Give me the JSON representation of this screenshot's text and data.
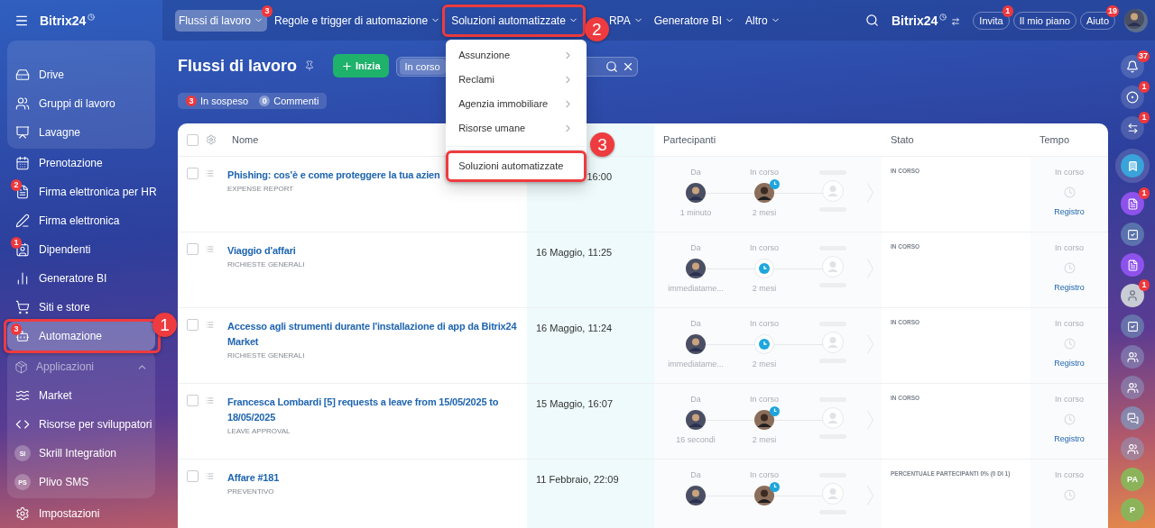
{
  "sidebar": {
    "logo": "Bitrix24",
    "pinned": [
      {
        "label": "Drive",
        "selected": false
      },
      {
        "label": "Gruppi di lavoro",
        "selected": false
      },
      {
        "label": "Lavagne",
        "selected": false
      }
    ],
    "items": [
      {
        "label": "Prenotazione",
        "selected": false
      },
      {
        "label": "Firma elettronica per HR",
        "selected": false,
        "badge": "2"
      },
      {
        "label": "Firma elettronica",
        "selected": false
      },
      {
        "label": "Dipendenti",
        "selected": false,
        "badge": "1"
      },
      {
        "label": "Generatore BI",
        "selected": false
      },
      {
        "label": "Siti e store",
        "selected": false
      },
      {
        "label": "Automazione",
        "selected": true,
        "badge": "3",
        "callout": "1"
      }
    ],
    "apps": {
      "title": "Applicazioni",
      "expanded": true,
      "items": [
        {
          "label": "Market"
        },
        {
          "label": "Risorse per sviluppatori"
        },
        {
          "label": "Skrill Integration",
          "initials": "SI"
        },
        {
          "label": "Plivo SMS",
          "initials": "PS"
        }
      ]
    },
    "settings": "Impostazioni"
  },
  "topbar": {
    "tabs": [
      {
        "label": "Flussi di lavoro",
        "selected": true,
        "badge": "3"
      },
      {
        "label": "Regole e trigger di automazione",
        "selected": false
      },
      {
        "label": "Soluzioni automatizzate",
        "selected": false,
        "callout": "2",
        "open": true
      },
      {
        "label": "RPA",
        "selected": false
      },
      {
        "label": "Generatore BI",
        "selected": false
      },
      {
        "label": "Altro",
        "selected": false
      }
    ],
    "logo": "Bitrix24",
    "buttons": [
      {
        "label": "Invita",
        "badge": "1"
      },
      {
        "label": "Il mio piano"
      },
      {
        "label": "Aiuto",
        "badge": "19"
      }
    ]
  },
  "menu": {
    "items": [
      {
        "label": "Assunzione",
        "kind": "submenu"
      },
      {
        "label": "Reclami",
        "kind": "submenu"
      },
      {
        "label": "Agenzia immobiliare",
        "kind": "submenu"
      },
      {
        "label": "Risorse umane",
        "kind": "submenu"
      },
      {
        "label": "Soluzioni automatizzate",
        "kind": "action",
        "callout": "3"
      }
    ]
  },
  "page": {
    "title": "Flussi di lavoro",
    "start_button": "Inizia",
    "filter_chip": "In corso",
    "counters": [
      {
        "count": "3",
        "label": "In sospeso",
        "kind": "alert"
      },
      {
        "count": "0",
        "label": "Commenti",
        "kind": "plain"
      }
    ]
  },
  "table": {
    "all_checked": false,
    "header": {
      "name": "Nome",
      "participants": "Partecipanti",
      "status": "Stato",
      "time": "Tempo"
    },
    "rows": [
      {
        "title": "Phishing: cos'è e come proteggere la tua azien",
        "type": "EXPENSE REPORT",
        "date": "16:00",
        "checked": false,
        "from": {
          "label": "Da",
          "time": "1 minuto"
        },
        "current": {
          "label": "In corso",
          "time": "2 mesi",
          "photo": true
        },
        "status": "IN CORSO",
        "time_state": "In corso",
        "log": "Registro"
      },
      {
        "title": "Viaggio d'affari",
        "type": "RICHIESTE GENERALI",
        "date": "16 Maggio, 11:25",
        "checked": false,
        "from": {
          "label": "Da",
          "time": "immediatame..."
        },
        "current": {
          "label": "In corso",
          "time": "2 mesi",
          "photo": false
        },
        "status": "IN CORSO",
        "time_state": "In corso",
        "log": "Registro"
      },
      {
        "title": "Accesso agli strumenti durante l'installazione di app da Bitrix24 Market",
        "type": "RICHIESTE GENERALI",
        "date": "16 Maggio, 11:24",
        "checked": false,
        "from": {
          "label": "Da",
          "time": "immediatame..."
        },
        "current": {
          "label": "In corso",
          "time": "2 mesi",
          "photo": false
        },
        "status": "IN CORSO",
        "time_state": "In corso",
        "log": "Registro"
      },
      {
        "title": "Francesca Lombardi [5] requests a leave from 15/05/2025 to 18/05/2025",
        "type": "LEAVE APPROVAL",
        "date": "15 Maggio, 16:07",
        "checked": false,
        "from": {
          "label": "Da",
          "time": "16 secondi"
        },
        "current": {
          "label": "In corso",
          "time": "2 mesi",
          "photo": true
        },
        "status": "IN CORSO",
        "time_state": "In corso",
        "log": "Registro"
      },
      {
        "title": "Affare #181",
        "type": "PREVENTIVO",
        "date": "11 Febbraio, 22:09",
        "checked": false,
        "from": {
          "label": "Da"
        },
        "current": {
          "label": "In corso",
          "photo": true
        },
        "status": "PERCENTUALE PARTECIPANTI 0% (0 DI 1)",
        "time_state": "In corso"
      }
    ]
  },
  "rail": [
    {
      "kind": "bell",
      "badge": "37"
    },
    {
      "kind": "spiral",
      "badge": "1"
    },
    {
      "kind": "chat",
      "badge": "1"
    },
    {
      "kind": "bookmark"
    },
    {
      "kind": "form",
      "badge": "1"
    },
    {
      "kind": "task"
    },
    {
      "kind": "form"
    },
    {
      "kind": "avatar",
      "badge": "1"
    },
    {
      "kind": "task"
    },
    {
      "kind": "group"
    },
    {
      "kind": "group"
    },
    {
      "kind": "comment"
    },
    {
      "kind": "group"
    },
    {
      "kind": "initials",
      "text": "PA"
    },
    {
      "kind": "initials",
      "text": "P"
    }
  ]
}
